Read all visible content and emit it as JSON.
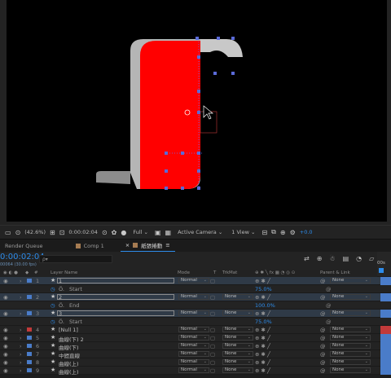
{
  "viewer": {
    "zoom": "(42.6%)",
    "time": "0:00:02:04",
    "resolution": "Full",
    "camera": "Active Camera",
    "view": "1 View",
    "exposure": "+0.0"
  },
  "tabs": [
    {
      "label": "Render Queue",
      "color": "#00000000"
    },
    {
      "label": "Comp 1",
      "color": "#a67c52"
    },
    {
      "label": "紙張捲動",
      "color": "#a67c52"
    }
  ],
  "timeline": {
    "timecode": "0:00:02:04",
    "fps": "00064 (30.00 fps)",
    "search_placeholder": "ρ▾",
    "ruler_label": "00s"
  },
  "columns": {
    "layer_name": "Layer Name",
    "mode": "Mode",
    "t": "T",
    "trkmat": "TrkMat",
    "parent": "Parent & Link"
  },
  "rows": [
    {
      "type": "layer",
      "num": "1",
      "name": "1",
      "mode": "Normal",
      "trkmat": "",
      "parent": "None",
      "color": "#4a7cc9",
      "selected": true
    },
    {
      "type": "prop",
      "name": "Start",
      "value": "75.0%"
    },
    {
      "type": "layer",
      "num": "2",
      "name": "2",
      "mode": "Normal",
      "trkmat": "None",
      "parent": "None",
      "color": "#4a7cc9",
      "selected": true
    },
    {
      "type": "prop",
      "name": "End",
      "value": "100.0%"
    },
    {
      "type": "layer",
      "num": "3",
      "name": "3",
      "mode": "Normal",
      "trkmat": "None",
      "parent": "None",
      "color": "#4a7cc9",
      "selected": true
    },
    {
      "type": "prop",
      "name": "Start",
      "value": "75.0%"
    },
    {
      "type": "layer",
      "num": "4",
      "name": "[Null 1]",
      "mode": "Normal",
      "trkmat": "None",
      "parent": "None",
      "color": "#c23a3a",
      "selected": false
    },
    {
      "type": "layer",
      "num": "5",
      "name": "曲線(下) 2",
      "mode": "Normal",
      "trkmat": "None",
      "parent": "None",
      "color": "#4a7cc9",
      "selected": false
    },
    {
      "type": "layer",
      "num": "6",
      "name": "曲線(下)",
      "mode": "Normal",
      "trkmat": "None",
      "parent": "None",
      "color": "#4a7cc9",
      "selected": false
    },
    {
      "type": "layer",
      "num": "7",
      "name": "中間直線",
      "mode": "Normal",
      "trkmat": "None",
      "parent": "None",
      "color": "#4a7cc9",
      "selected": false
    },
    {
      "type": "layer",
      "num": "8",
      "name": "曲線(上)",
      "mode": "Normal",
      "trkmat": "None",
      "parent": "None",
      "color": "#4a7cc9",
      "selected": false
    },
    {
      "type": "layer",
      "num": "9",
      "name": "曲線(上)",
      "mode": "Normal",
      "trkmat": "None",
      "parent": "None",
      "color": "#4a7cc9",
      "selected": false
    }
  ]
}
